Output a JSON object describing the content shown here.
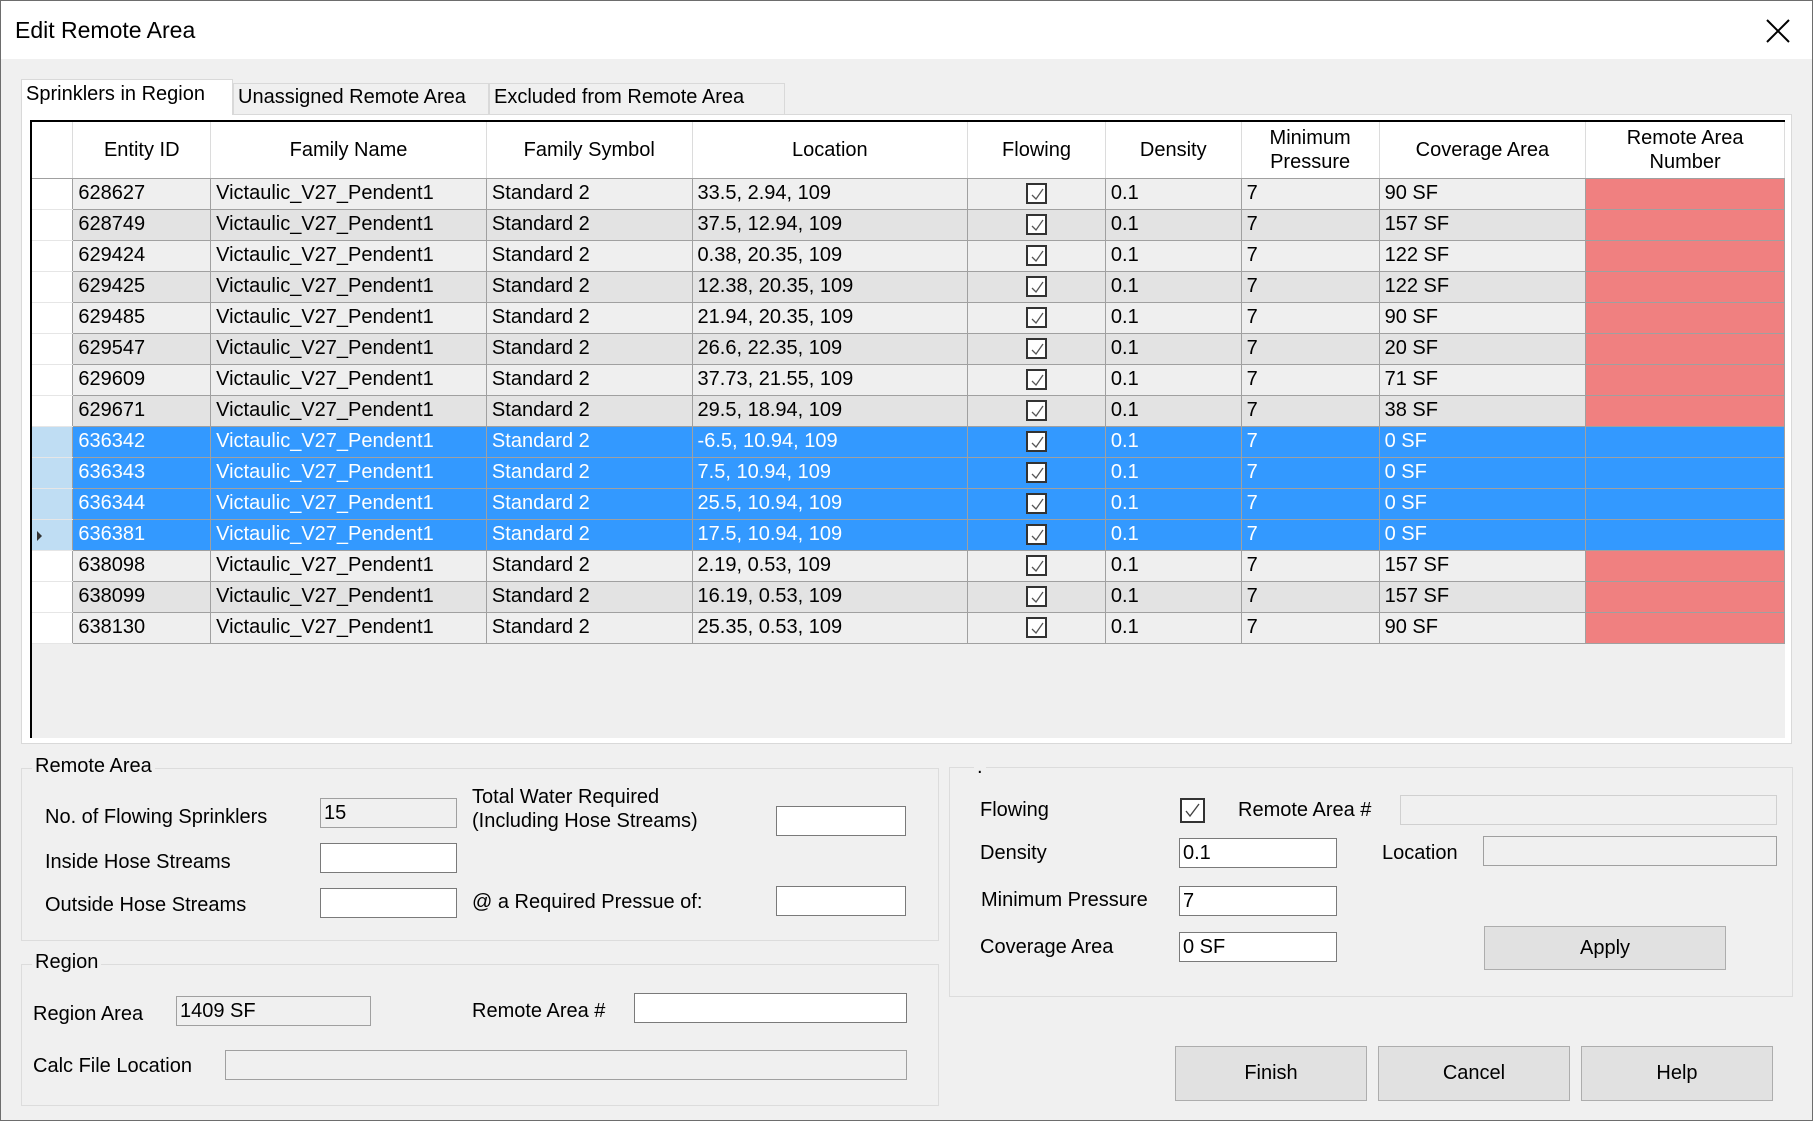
{
  "window": {
    "title": "Edit Remote Area"
  },
  "tabs": [
    {
      "label": "Sprinklers in Region",
      "active": true
    },
    {
      "label": "Unassigned Remote Area",
      "active": false
    },
    {
      "label": "Excluded from Remote Area",
      "active": false
    }
  ],
  "grid": {
    "columns": [
      "Entity ID",
      "Family Name",
      "Family Symbol",
      "Location",
      "Flowing",
      "Density",
      "Minimum Pressure",
      "Coverage Area",
      "Remote Area Number"
    ],
    "colors": {
      "selected": "#3399ff",
      "selected_rowheader": "#bfddf3",
      "alt_row": "#e3e3e3",
      "remote_unassigned": "#f08080"
    },
    "rows": [
      {
        "id": "628627",
        "family": "Victaulic_V27_Pendent1",
        "symbol": "Standard 2",
        "location": "33.5, 2.94, 109",
        "flowing": true,
        "density": "0.1",
        "pressure": "7",
        "coverage": "90 SF",
        "remote": "",
        "selected": false
      },
      {
        "id": "628749",
        "family": "Victaulic_V27_Pendent1",
        "symbol": "Standard 2",
        "location": "37.5, 12.94, 109",
        "flowing": true,
        "density": "0.1",
        "pressure": "7",
        "coverage": "157 SF",
        "remote": "",
        "selected": false
      },
      {
        "id": "629424",
        "family": "Victaulic_V27_Pendent1",
        "symbol": "Standard 2",
        "location": "0.38, 20.35, 109",
        "flowing": true,
        "density": "0.1",
        "pressure": "7",
        "coverage": "122 SF",
        "remote": "",
        "selected": false
      },
      {
        "id": "629425",
        "family": "Victaulic_V27_Pendent1",
        "symbol": "Standard 2",
        "location": "12.38, 20.35, 109",
        "flowing": true,
        "density": "0.1",
        "pressure": "7",
        "coverage": "122 SF",
        "remote": "",
        "selected": false
      },
      {
        "id": "629485",
        "family": "Victaulic_V27_Pendent1",
        "symbol": "Standard 2",
        "location": "21.94, 20.35, 109",
        "flowing": true,
        "density": "0.1",
        "pressure": "7",
        "coverage": "90 SF",
        "remote": "",
        "selected": false
      },
      {
        "id": "629547",
        "family": "Victaulic_V27_Pendent1",
        "symbol": "Standard 2",
        "location": "26.6, 22.35, 109",
        "flowing": true,
        "density": "0.1",
        "pressure": "7",
        "coverage": "20 SF",
        "remote": "",
        "selected": false
      },
      {
        "id": "629609",
        "family": "Victaulic_V27_Pendent1",
        "symbol": "Standard 2",
        "location": "37.73, 21.55, 109",
        "flowing": true,
        "density": "0.1",
        "pressure": "7",
        "coverage": "71 SF",
        "remote": "",
        "selected": false
      },
      {
        "id": "629671",
        "family": "Victaulic_V27_Pendent1",
        "symbol": "Standard 2",
        "location": "29.5, 18.94, 109",
        "flowing": true,
        "density": "0.1",
        "pressure": "7",
        "coverage": "38 SF",
        "remote": "",
        "selected": false
      },
      {
        "id": "636342",
        "family": "Victaulic_V27_Pendent1",
        "symbol": "Standard 2",
        "location": "-6.5, 10.94, 109",
        "flowing": true,
        "density": "0.1",
        "pressure": "7",
        "coverage": "0 SF",
        "remote": "",
        "selected": true
      },
      {
        "id": "636343",
        "family": "Victaulic_V27_Pendent1",
        "symbol": "Standard 2",
        "location": "7.5, 10.94, 109",
        "flowing": true,
        "density": "0.1",
        "pressure": "7",
        "coverage": "0 SF",
        "remote": "",
        "selected": true
      },
      {
        "id": "636344",
        "family": "Victaulic_V27_Pendent1",
        "symbol": "Standard 2",
        "location": "25.5, 10.94, 109",
        "flowing": true,
        "density": "0.1",
        "pressure": "7",
        "coverage": "0 SF",
        "remote": "",
        "selected": true
      },
      {
        "id": "636381",
        "family": "Victaulic_V27_Pendent1",
        "symbol": "Standard 2",
        "location": "17.5, 10.94, 109",
        "flowing": true,
        "density": "0.1",
        "pressure": "7",
        "coverage": "0 SF",
        "remote": "",
        "selected": true,
        "current": true
      },
      {
        "id": "638098",
        "family": "Victaulic_V27_Pendent1",
        "symbol": "Standard 2",
        "location": "2.19, 0.53, 109",
        "flowing": true,
        "density": "0.1",
        "pressure": "7",
        "coverage": "157 SF",
        "remote": "",
        "selected": false
      },
      {
        "id": "638099",
        "family": "Victaulic_V27_Pendent1",
        "symbol": "Standard 2",
        "location": "16.19, 0.53, 109",
        "flowing": true,
        "density": "0.1",
        "pressure": "7",
        "coverage": "157 SF",
        "remote": "",
        "selected": false
      },
      {
        "id": "638130",
        "family": "Victaulic_V27_Pendent1",
        "symbol": "Standard 2",
        "location": "25.35, 0.53, 109",
        "flowing": true,
        "density": "0.1",
        "pressure": "7",
        "coverage": "90 SF",
        "remote": "",
        "selected": false
      }
    ]
  },
  "remote_area": {
    "title": "Remote Area",
    "flowing_sprinklers_label": "No. of Flowing Sprinklers",
    "flowing_sprinklers_value": "15",
    "inside_hose_label": "Inside Hose Streams",
    "inside_hose_value": "",
    "outside_hose_label": "Outside Hose Streams",
    "outside_hose_value": "",
    "total_water_label_1": "Total Water Required",
    "total_water_label_2": "(Including Hose Streams)",
    "total_water_value": "",
    "required_pressure_label": "@ a Required Pressue of:",
    "required_pressure_value": ""
  },
  "region": {
    "title": "Region",
    "area_label": "Region Area",
    "area_value": "1409 SF",
    "remote_area_num_label": "Remote Area #",
    "remote_area_num_value": "",
    "calc_file_label": "Calc File Location",
    "calc_file_value": ""
  },
  "editor": {
    "title": ".",
    "flowing_label": "Flowing",
    "flowing_checked": true,
    "remote_area_num_label": "Remote Area #",
    "remote_area_num_value": "",
    "density_label": "Density",
    "density_value": "0.1",
    "location_label": "Location",
    "location_value": "",
    "min_pressure_label": "Minimum Pressure",
    "min_pressure_value": "7",
    "coverage_label": "Coverage Area",
    "coverage_value": "0 SF",
    "apply_label": "Apply"
  },
  "footer": {
    "finish_label": "Finish",
    "cancel_label": "Cancel",
    "help_label": "Help"
  }
}
